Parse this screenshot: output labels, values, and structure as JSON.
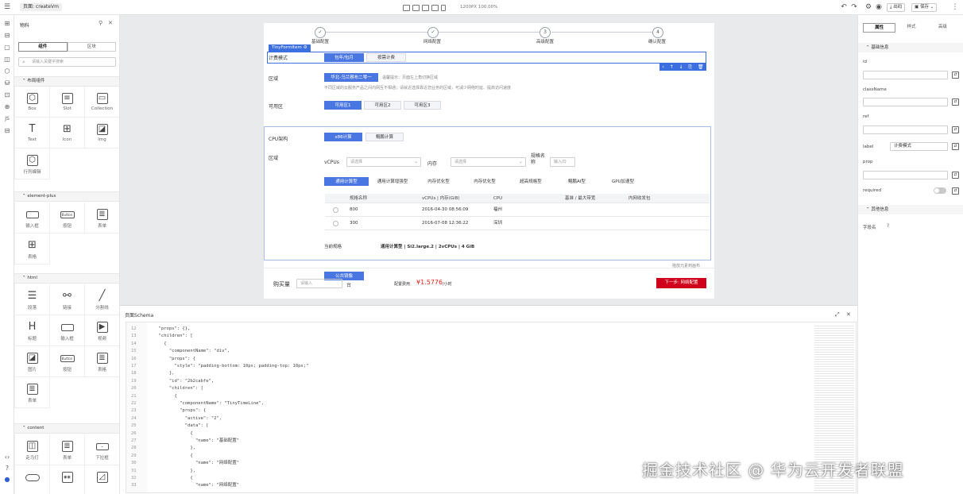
{
  "topbar": {
    "page_label": "页面: createVm",
    "canvas_size": "1200PX  100.00%",
    "publish_label": "出码",
    "save_label": "保存"
  },
  "left_panel": {
    "title": "物料",
    "tab_component": "组件",
    "tab_block": "区块",
    "search_placeholder": "请输入关键字搜索",
    "groups": [
      {
        "title": "布局组件",
        "items": [
          {
            "label": "Box",
            "icon": "box-icon"
          },
          {
            "label": "Slot",
            "icon": "slot-icon"
          },
          {
            "label": "Collection",
            "icon": "collection-icon"
          },
          {
            "label": "Text",
            "icon": "text-icon"
          },
          {
            "label": "Icon",
            "icon": "icon-grid-icon"
          },
          {
            "label": "Img",
            "icon": "image-icon"
          },
          {
            "label": "行列编辑",
            "icon": "cube-icon"
          }
        ]
      },
      {
        "title": "element-plus",
        "items": [
          {
            "label": "输入框",
            "icon": "input-icon"
          },
          {
            "label": "按钮",
            "icon": "button-icon"
          },
          {
            "label": "表单",
            "icon": "form-icon"
          },
          {
            "label": "表格",
            "icon": "table-icon"
          }
        ]
      },
      {
        "title": "html",
        "items": [
          {
            "label": "段落",
            "icon": "paragraph-icon"
          },
          {
            "label": "链接",
            "icon": "link-icon"
          },
          {
            "label": "分割线",
            "icon": "divider-icon"
          },
          {
            "label": "标题",
            "icon": "heading-icon"
          },
          {
            "label": "输入框",
            "icon": "input-icon"
          },
          {
            "label": "视频",
            "icon": "video-icon"
          },
          {
            "label": "图片",
            "icon": "picture-icon"
          },
          {
            "label": "按钮",
            "icon": "button-icon"
          },
          {
            "label": "表格",
            "icon": "table-icon"
          },
          {
            "label": "表单",
            "icon": "form-icon"
          }
        ]
      },
      {
        "title": "content",
        "items": [
          {
            "label": "走马灯",
            "icon": "carousel-icon"
          },
          {
            "label": "表单",
            "icon": "form-icon"
          },
          {
            "label": "下拉框",
            "icon": "select-icon"
          }
        ]
      }
    ]
  },
  "form": {
    "steps": [
      "基础配置",
      "网络配置",
      "高级配置",
      "确认配置"
    ],
    "selected_tag": "TinyFormItem",
    "billing_label": "计费模式",
    "billing_options": [
      "包年/包月",
      "按需计费"
    ],
    "region_label": "区域",
    "region_value": "华北-乌兰察布二零一",
    "region_hint": "温馨提示：页面左上角切换区域",
    "region_desc": "不同区域的云服务产品之间内网互不相通；请就近选择靠近您业务的区域，可减少网络时延、提高访问速度",
    "az_label": "可用区",
    "az_options": [
      "可用区1",
      "可用区2",
      "可用区3"
    ],
    "cpu_label": "CPU架构",
    "cpu_options": [
      "x86计算",
      "鲲鹏计算"
    ],
    "spec_label": "区域",
    "vcpu_label": "vCPUs",
    "vcpu_placeholder": "请选择",
    "mem_label": "内存",
    "mem_placeholder": "请选择",
    "spec_name_label": "规格名称",
    "spec_input_placeholder": "输入/Q",
    "type_tabs": [
      "通用计算型",
      "通用计算增强型",
      "内存优化型",
      "内存优化型",
      "超高规格型",
      "鲲鹏AI型",
      "GPU加速型"
    ],
    "table_headers": [
      "规格名称",
      "vCPUs | 内存(GiB)",
      "CPU",
      "基准 / 最大带宽",
      "内网收发包"
    ],
    "rows": [
      {
        "name": "800",
        "date": "2016-04-30 08:56:09",
        "cpu": "福州"
      },
      {
        "name": "300",
        "date": "2016-07-08 12:36:22",
        "cpu": "深圳"
      }
    ],
    "current_spec_label": "当前规格",
    "current_spec_value": "通用计算型 | Si2.large.2 | 2vCPUs | 4 GiB",
    "footer_hint": "拖放元素到画布",
    "public_btn": "公共镜像",
    "qty_label": "购买量",
    "qty_placeholder": "请输入",
    "qty_unit": "台",
    "price_label": "配置费用",
    "price_value": "¥1.5776",
    "price_unit": "/小时",
    "next_btn": "下一步: 网络配置"
  },
  "right_panel": {
    "tabs": [
      "属性",
      "样式",
      "高级"
    ],
    "group_basic": "基础信息",
    "fields": [
      {
        "label": "id",
        "value": ""
      },
      {
        "label": "className",
        "value": ""
      },
      {
        "label": "ref",
        "value": ""
      },
      {
        "label": "label",
        "value": "计费模式"
      },
      {
        "label": "prop",
        "value": ""
      }
    ],
    "required_label": "required",
    "group_other": "其他信息",
    "sort_label": "字段名"
  },
  "schema": {
    "title": "页面Schema",
    "lines": [
      {
        "n": "12",
        "t": "  \"props\": {},"
      },
      {
        "n": "13",
        "t": "  \"children\": ["
      },
      {
        "n": "14",
        "t": "    {"
      },
      {
        "n": "15",
        "t": "      \"componentName\": \"div\","
      },
      {
        "n": "16",
        "t": "      \"props\": {"
      },
      {
        "n": "17",
        "t": "        \"style\": \"padding-bottom: 10px; padding-top: 10px;\""
      },
      {
        "n": "18",
        "t": "      },"
      },
      {
        "n": "19",
        "t": "      \"id\": \"2b2cabfe\","
      },
      {
        "n": "20",
        "t": "      \"children\": ["
      },
      {
        "n": "21",
        "t": "        {"
      },
      {
        "n": "22",
        "t": "          \"componentName\": \"TinyTimeLine\","
      },
      {
        "n": "23",
        "t": "          \"props\": {"
      },
      {
        "n": "24",
        "t": "            \"active\": \"2\","
      },
      {
        "n": "25",
        "t": "            \"data\": ["
      },
      {
        "n": "26",
        "t": "              {"
      },
      {
        "n": "27",
        "t": "                \"name\": \"基础配置\""
      },
      {
        "n": "28",
        "t": "              },"
      },
      {
        "n": "29",
        "t": "              {"
      },
      {
        "n": "30",
        "t": "                \"name\": \"网络配置\""
      },
      {
        "n": "31",
        "t": "              },"
      },
      {
        "n": "32",
        "t": "              {"
      },
      {
        "n": "33",
        "t": "                \"name\": \"网络配置\""
      }
    ]
  },
  "watermark": "掘金技术社区 @ 华为云开发者联盟",
  "colors": {
    "accent": "#4a76e2",
    "danger": "#d0021b",
    "selection": "#3c6fe0"
  }
}
